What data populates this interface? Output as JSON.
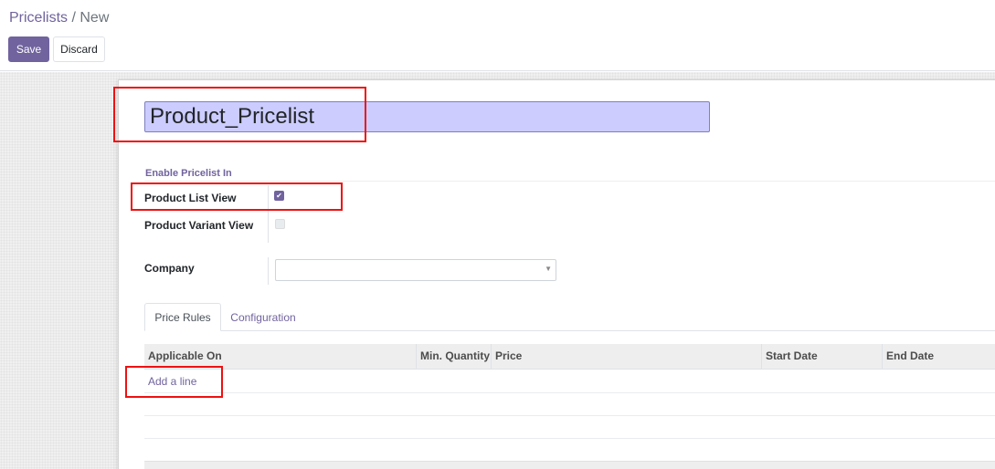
{
  "breadcrumb": {
    "parent": "Pricelists",
    "separator": "/",
    "current": "New"
  },
  "buttons": {
    "save": "Save",
    "discard": "Discard"
  },
  "form": {
    "name_value": "Product_Pricelist",
    "group_title": "Enable Pricelist In",
    "fields": {
      "product_list_view": {
        "label": "Product List View",
        "checked": true
      },
      "product_variant_view": {
        "label": "Product Variant View",
        "checked": false
      },
      "company": {
        "label": "Company",
        "value": ""
      }
    }
  },
  "tabs": [
    {
      "label": "Price Rules",
      "active": true
    },
    {
      "label": "Configuration",
      "active": false
    }
  ],
  "table": {
    "columns": [
      "Applicable On",
      "Min. Quantity",
      "Price",
      "Start Date",
      "End Date"
    ],
    "add_line_label": "Add a line"
  },
  "colors": {
    "accent": "#71639e",
    "highlight": "#ee1111",
    "name_field_bg": "#ccccff"
  },
  "icons": {
    "checkbox_checked": "check-icon",
    "dropdown": "caret-down-icon"
  }
}
